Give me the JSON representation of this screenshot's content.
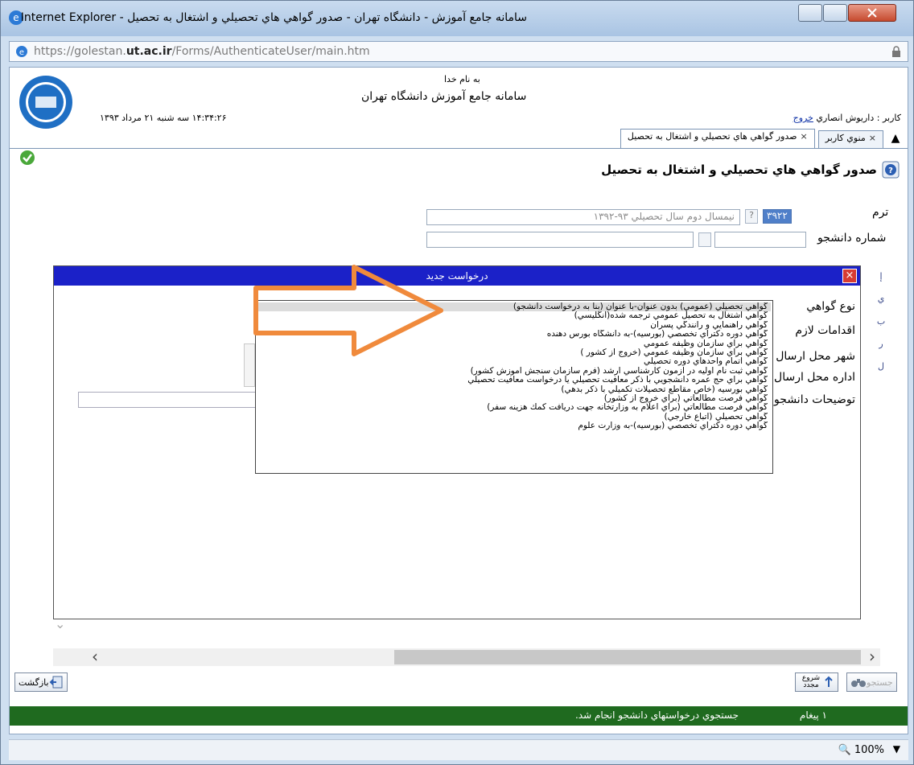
{
  "window": {
    "title": "سامانه جامع آموزش - دانشگاه تهران - صدور گواهي هاي تحصيلي و اشتغال به تحصيل - Internet Explorer",
    "address_prefix": "https://golestan.",
    "address_host": "ut.ac.ir",
    "address_path": "/Forms/AuthenticateUser/main.htm"
  },
  "header": {
    "bismillah": "به نام خدا",
    "system_title": "سامانه جامع آموزش   دانشگاه تهران",
    "datetime": "۱۴:۳۴:۲۶ سه شنبه ۲۱ مرداد ۱۳۹۳",
    "user_label": "کاربر : داريوش انصاري",
    "logout": "خروج",
    "logo_text": "تهران دانشگاه"
  },
  "tabs": [
    {
      "label": "منوي کاربر"
    },
    {
      "label": "صدور گواهي هاي تحصيلي و اشتغال به تحصيل"
    }
  ],
  "page": {
    "heading": "صدور گواهي هاي تحصيلي و اشتغال به تحصيل",
    "term_label": "ترم",
    "term_code": "۳۹۲۲",
    "term_question": "?",
    "term_value": "نيمسال دوم سال تحصيلي ۹۳-۱۳۹۲",
    "student_label": "شماره دانشجو"
  },
  "dialog": {
    "title": "درخواست جديد",
    "close": "×",
    "labels": {
      "cert_type": "نوع گواهي",
      "actions": "اقدامات لازم",
      "city": "شهر محل ارسال",
      "office": "اداره محل ارسال",
      "description": "توضيحات دانشجو"
    },
    "options": [
      "گواهي تحصيلي (عمومي) بدون عنوان-با عنوان (بنا به درخواست دانشجو)",
      "گواهي اشتغال به تحصيل عمومي ترجمه شده(انگليسي)",
      "گواهي راهنمايي و رانندگي پسران",
      "گواهي دوره دكتراي تخصصي (بورسيه)-به دانشگاه بورس دهنده",
      "گواهي براي سازمان وظيفه عمومي",
      "گواهي براي سازمان وظيفه عمومي (خروج از كشور )",
      "گواهي اتمام واحدهاي دوره تحصيلي",
      "گواهي ثبت نام اوليه در آزمون كارشناسي ارشد (فرم سازمان سنجش آموزش كشور)",
      "گواهي براي حج عمره دانشجويي با ذكر معافيت تحصيلي يا درخواست معافيت تحصيلي",
      "گواهي بورسيه (خاص مقاطع تحصيلات تكميلي با ذكر بدهي)",
      "گواهي فرصت مطالعاتي (براي خروج از كشور)",
      "گواهي فرصت مطالعاتي (براي اعلام به وزارتخانه جهت دريافت كمك هزينه سفر)",
      "گواهي تحصيلي (اتباع خارجي)",
      "گواهي دوره دكتراي تخصصي (بورسيه)-به وزارت علوم"
    ],
    "side_letters": [
      "إ",
      "ي",
      "ب",
      "ر",
      "ل"
    ]
  },
  "footer": {
    "back_label": "بازگشت",
    "restart_label": "شروع مجدد",
    "search_label": "جستجو",
    "message_count": "۱ پيغام",
    "message_text": "جستجوي درخواستهاي دانشجو انجام شد.",
    "zoom": "100%"
  },
  "colors": {
    "dialog_title": "#1b21c8",
    "status_bar": "#1f6a1f",
    "arrow": "#f08a3c"
  }
}
